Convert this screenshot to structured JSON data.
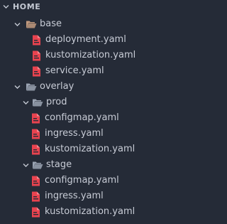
{
  "explorer": {
    "section_title": "HOME",
    "tree": [
      {
        "kind": "folder",
        "label": "base",
        "depth": 1,
        "expanded": true,
        "icon": "folder-open-icon-brown"
      },
      {
        "kind": "file",
        "label": "deployment.yaml",
        "depth": 2,
        "icon": "yaml-file-icon"
      },
      {
        "kind": "file",
        "label": "kustomization.yaml",
        "depth": 2,
        "icon": "yaml-file-icon"
      },
      {
        "kind": "file",
        "label": "service.yaml",
        "depth": 2,
        "icon": "yaml-file-icon"
      },
      {
        "kind": "folder",
        "label": "overlay",
        "depth": 1,
        "expanded": true,
        "icon": "folder-open-icon"
      },
      {
        "kind": "folder",
        "label": "prod",
        "depth": 2,
        "expanded": true,
        "icon": "folder-open-icon"
      },
      {
        "kind": "file",
        "label": "configmap.yaml",
        "depth": 3,
        "icon": "yaml-file-icon"
      },
      {
        "kind": "file",
        "label": "ingress.yaml",
        "depth": 3,
        "icon": "yaml-file-icon"
      },
      {
        "kind": "file",
        "label": "kustomization.yaml",
        "depth": 3,
        "icon": "yaml-file-icon"
      },
      {
        "kind": "folder",
        "label": "stage",
        "depth": 2,
        "expanded": true,
        "icon": "folder-open-icon"
      },
      {
        "kind": "file",
        "label": "configmap.yaml",
        "depth": 3,
        "icon": "yaml-file-icon"
      },
      {
        "kind": "file",
        "label": "ingress.yaml",
        "depth": 3,
        "icon": "yaml-file-icon"
      },
      {
        "kind": "file",
        "label": "kustomization.yaml",
        "depth": 3,
        "icon": "yaml-file-icon"
      }
    ]
  },
  "colors": {
    "background": "#252b37",
    "text": "#c8ccd6",
    "yaml_icon": "#e8434f",
    "folder_grey": "#9aa3b2",
    "folder_brown": "#c29a7e"
  }
}
